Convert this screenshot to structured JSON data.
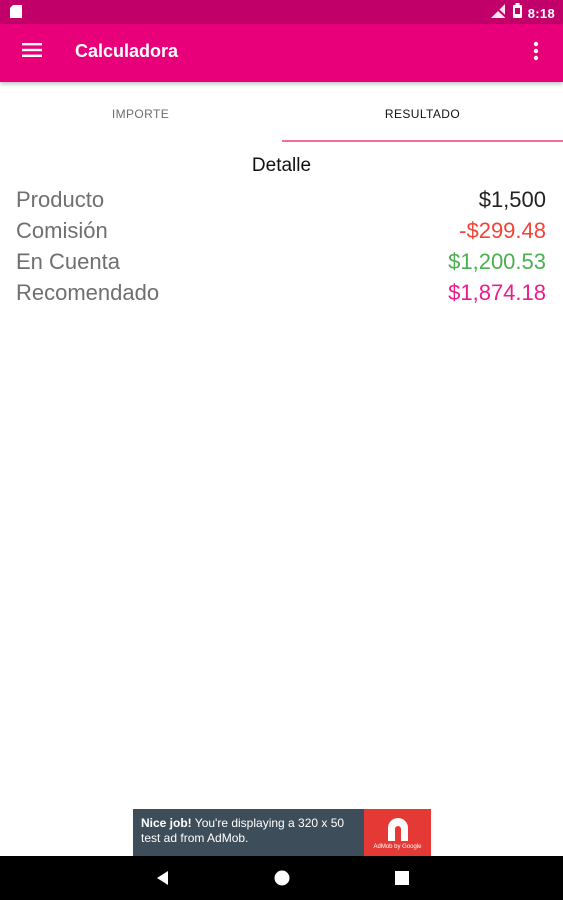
{
  "status_bar": {
    "time": "8:18"
  },
  "app_bar": {
    "title": "Calculadora"
  },
  "tabs": [
    {
      "label": "IMPORTE",
      "selected": false
    },
    {
      "label": "RESULTADO",
      "selected": true
    }
  ],
  "detail": {
    "title": "Detalle",
    "rows": [
      {
        "label": "Producto",
        "value": "$1,500",
        "color": "#222222"
      },
      {
        "label": "Comisión",
        "value": "-$299.48",
        "color": "#f44336"
      },
      {
        "label": "En Cuenta",
        "value": "$1,200.53",
        "color": "#4caf50"
      },
      {
        "label": "Recomendado",
        "value": "$1,874.18",
        "color": "#e91e8c"
      }
    ]
  },
  "ad": {
    "headline": "Nice job!",
    "body": " You're displaying a 320 x 50 test ad from AdMob.",
    "brand": "AdMob by Google"
  },
  "colors": {
    "primary": "#e8007a",
    "primary_dark": "#c2006a",
    "tab_indicator": "#f06e9a"
  }
}
